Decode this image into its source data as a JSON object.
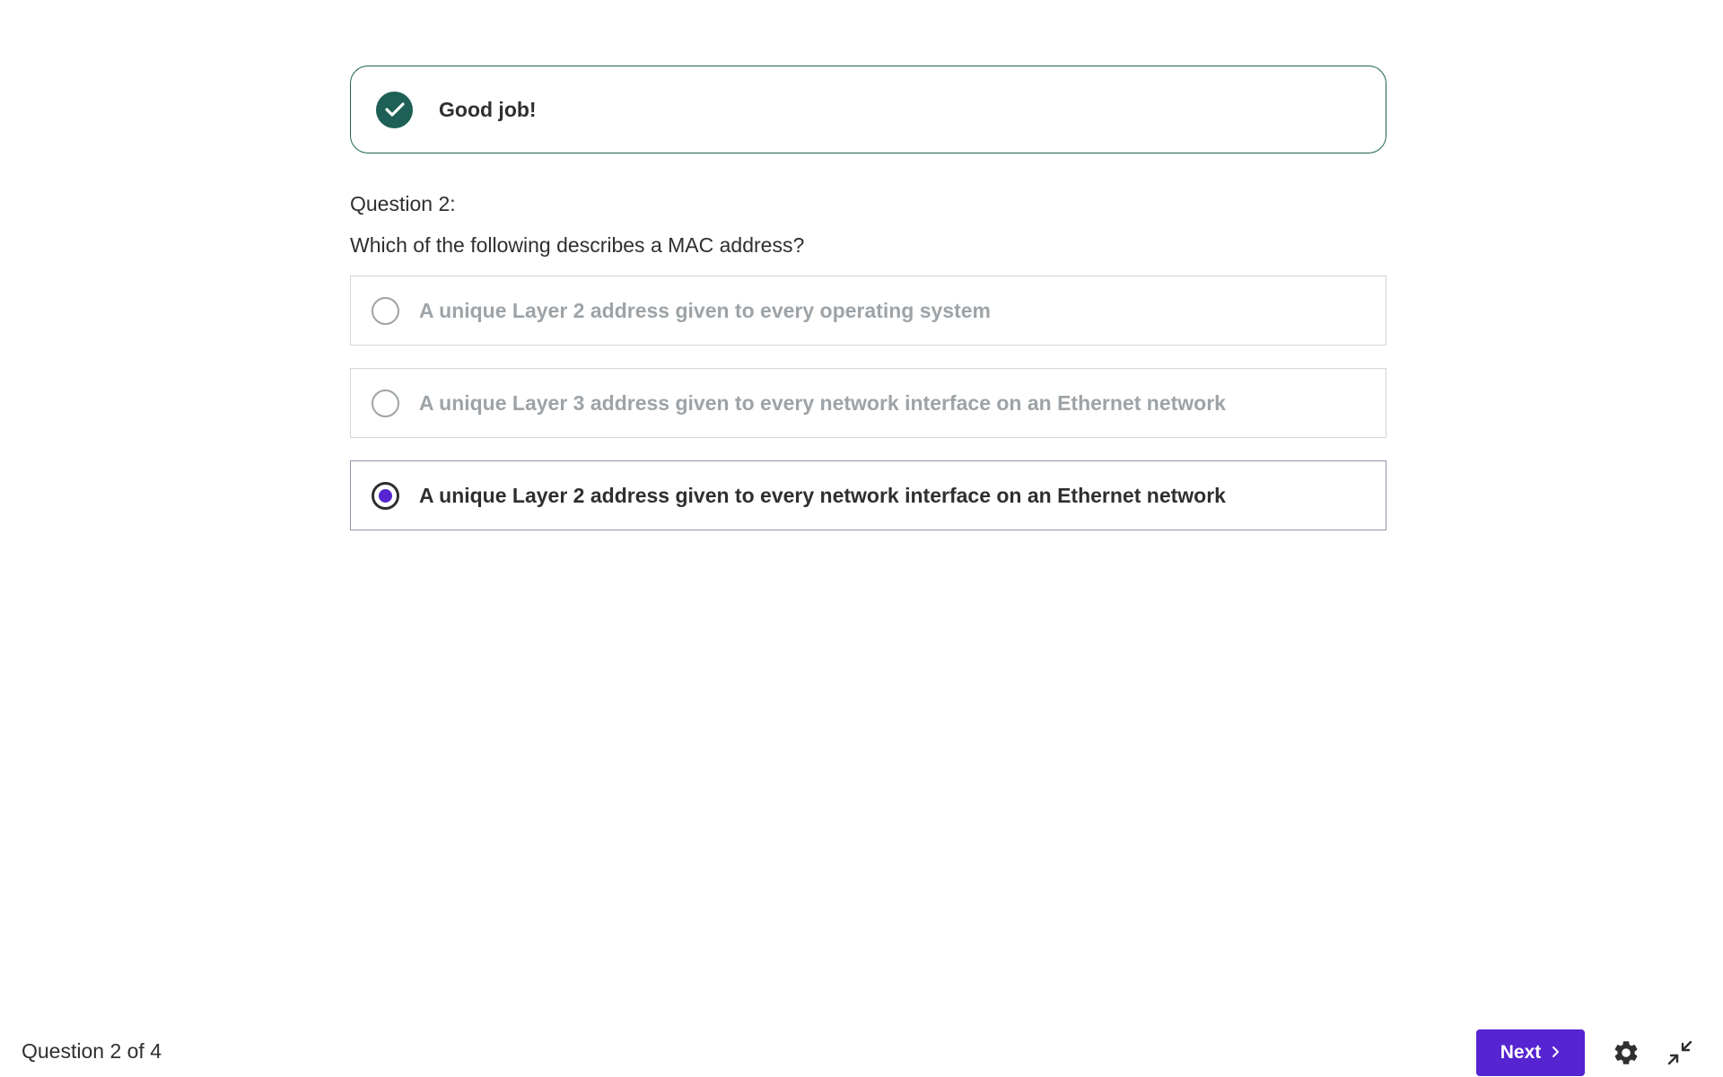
{
  "feedback": {
    "text": "Good job!",
    "icon": "check-circle-icon",
    "color": "#1e6055"
  },
  "question": {
    "number_label": "Question 2:",
    "text": "Which of the following describes a MAC address?"
  },
  "options": [
    {
      "label": "A unique Layer 2 address given to every operating system",
      "selected": false
    },
    {
      "label": "A unique Layer 3 address given to every network interface on an Ethernet network",
      "selected": false
    },
    {
      "label": "A unique Layer 2 address given to every network interface on an Ethernet network",
      "selected": true
    }
  ],
  "footer": {
    "progress": "Question 2 of 4",
    "next_label": "Next",
    "next_icon": "chevron-right-icon",
    "settings_icon": "gear-icon",
    "exit_fullscreen_icon": "collapse-icon"
  },
  "colors": {
    "accent": "#5624d0",
    "success": "#1e6055",
    "text": "#2d2f31",
    "muted": "#9da3a7"
  }
}
